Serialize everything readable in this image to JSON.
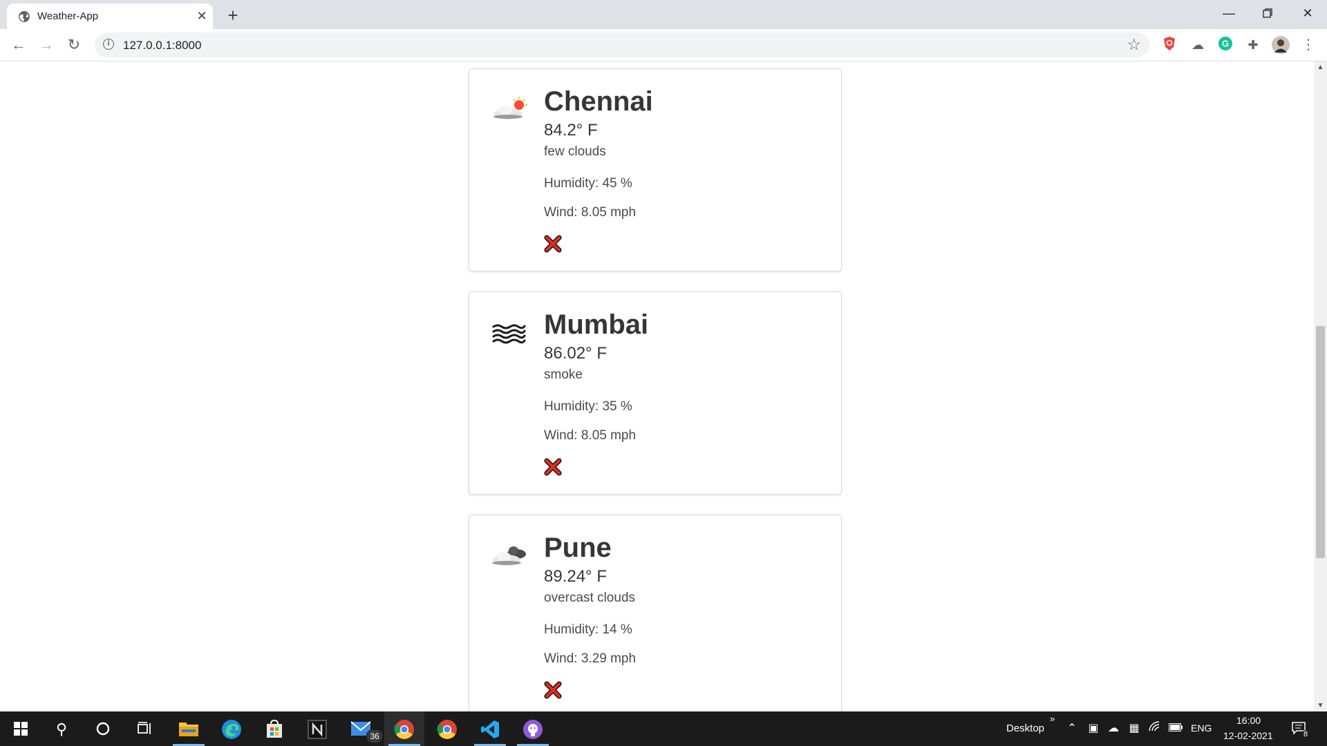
{
  "browser": {
    "tab": {
      "title": "Weather-App"
    },
    "new_tab_label": "+",
    "address": {
      "url": "127.0.0.1:8000"
    }
  },
  "cities": [
    {
      "name": "Chennai",
      "temperature": "84.2° F",
      "description": "few clouds",
      "humidity": "Humidity: 45 %",
      "wind": "Wind: 8.05 mph",
      "icon": "few-clouds-icon"
    },
    {
      "name": "Mumbai",
      "temperature": "86.02° F",
      "description": "smoke",
      "humidity": "Humidity: 35 %",
      "wind": "Wind: 8.05 mph",
      "icon": "smoke-icon"
    },
    {
      "name": "Pune",
      "temperature": "89.24° F",
      "description": "overcast clouds",
      "humidity": "Humidity: 14 %",
      "wind": "Wind: 3.29 mph",
      "icon": "overcast-clouds-icon"
    }
  ],
  "colors": {
    "delete": "#d93025",
    "taskbar": "#1b1b1b",
    "accent": "#76b9ed"
  },
  "taskbar": {
    "mail_badge": "36",
    "tray": {
      "desktop_label": "Desktop",
      "chevron": "»",
      "language": "ENG",
      "time": "16:00",
      "date": "12-02-2021",
      "notifications": "8"
    }
  }
}
